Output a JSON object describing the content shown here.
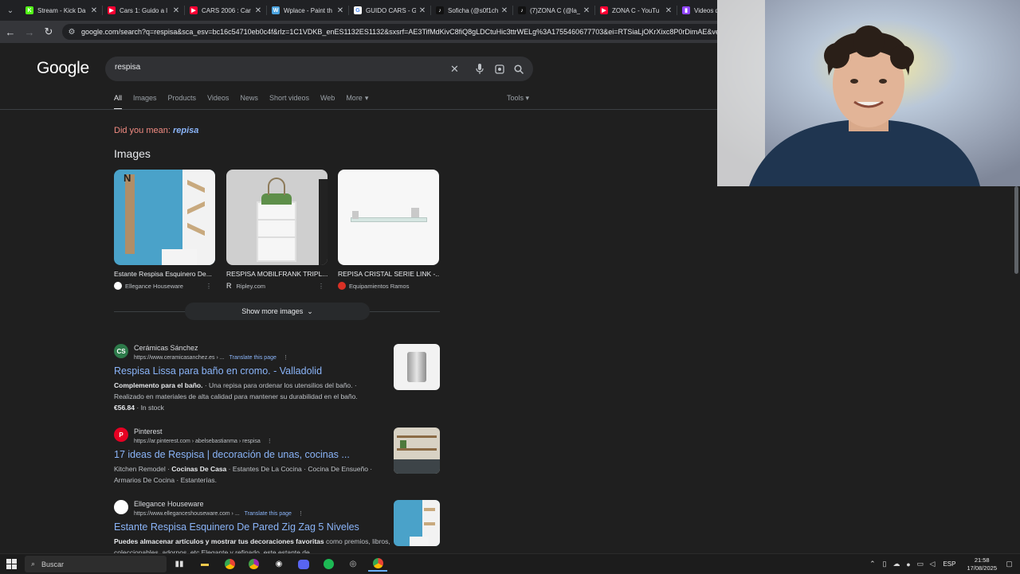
{
  "tabs": [
    {
      "title": "Stream - Kick Da",
      "icon": "kick-icon",
      "color": "#53fc18",
      "glyph": "K"
    },
    {
      "title": "Cars 1: Guido a l",
      "icon": "youtube-icon",
      "color": "#ff0033",
      "glyph": "▶"
    },
    {
      "title": "CARS 2006 : Car",
      "icon": "youtube-icon",
      "color": "#ff0033",
      "glyph": "▶"
    },
    {
      "title": "Wplace - Paint th",
      "icon": "wplace-icon",
      "color": "#4aa3df",
      "glyph": "W"
    },
    {
      "title": "GUIDO CARS - G",
      "icon": "google-icon",
      "color": "#ffffff",
      "glyph": "G"
    },
    {
      "title": "Soficha (@s0f1ch",
      "icon": "tiktok-icon",
      "color": "#111111",
      "glyph": "♪"
    },
    {
      "title": "(7)ZONA C (@la_",
      "icon": "tiktok-icon",
      "color": "#111111",
      "glyph": "♪"
    },
    {
      "title": "ZONA C - YouTu",
      "icon": "youtube-icon",
      "color": "#ff0033",
      "glyph": "▶"
    },
    {
      "title": "Videos de s",
      "icon": "twitch-icon",
      "color": "#9146ff",
      "glyph": "▮"
    }
  ],
  "url": "google.com/search?q=respisa&sca_esv=bc16c54710eb0c4f&rlz=1C1VDKB_enES1132ES1132&sxsrf=AE3TifMdKivC8fiQ8gLDCtuHic3ttrWELg%3A1755460677703&ei=RTSiaLjOKrXixc8P0rDimAE&ved=0ahUKEwj",
  "search": {
    "logo": "Google",
    "query": "respisa"
  },
  "filters": [
    "All",
    "Images",
    "Products",
    "Videos",
    "News",
    "Short videos",
    "Web",
    "More"
  ],
  "tools_label": "Tools",
  "did_you_mean": {
    "prefix": "Did you mean:",
    "suggestion": "repisa"
  },
  "images_heading": "Images",
  "images": [
    {
      "caption": "Estante Respisa Esquinero De...",
      "source": "Ellegance Houseware"
    },
    {
      "caption": "RESPISA MOBILFRANK TRIPL...",
      "source": "Ripley.com"
    },
    {
      "caption": "REPISA CRISTAL SERIE LINK -...",
      "source": "Equipamientos Ramos"
    }
  ],
  "show_more_images": "Show more images",
  "results": [
    {
      "site": "Cerámicas Sánchez",
      "url": "https://www.ceramicasanchez.es › ...",
      "translate": "Translate this page",
      "title": "Respisa Lissa para baño en cromo. - Valladolid",
      "snippet_bold": "Complemento para el baño.",
      "snippet": " · Una repisa para ordenar los utensilios del baño. · Realizado en materiales de alta calidad para mantener su durabilidad en el baño.",
      "price": "€56.84",
      "stock": "In stock"
    },
    {
      "site": "Pinterest",
      "url": "https://ar.pinterest.com › abelsebastianma › respisa",
      "title": "17 ideas de Respisa | decoración de unas, cocinas ...",
      "snippet_a": "Kitchen Remodel · ",
      "snippet_bold": "Cocinas De Casa",
      "snippet_b": " · Estantes De La Cocina · Cocina De Ensueño · Armarios De Cocina · Estanterías."
    },
    {
      "site": "Ellegance Houseware",
      "url": "https://www.elleganceshouseware.com › ...",
      "translate": "Translate this page",
      "title": "Estante Respisa Esquinero De Pared Zig Zag 5 Niveles",
      "snippet_bold": "Puedes almacenar artículos y mostrar tus decoraciones favoritas",
      "snippet": " como premios, libros, coleccionables, adornos, etc Elegante y refinado, este estante de ..."
    }
  ],
  "taskbar": {
    "search_label": "Buscar",
    "lang": "ESP",
    "time": "21:58",
    "date": "17/08/2025"
  }
}
